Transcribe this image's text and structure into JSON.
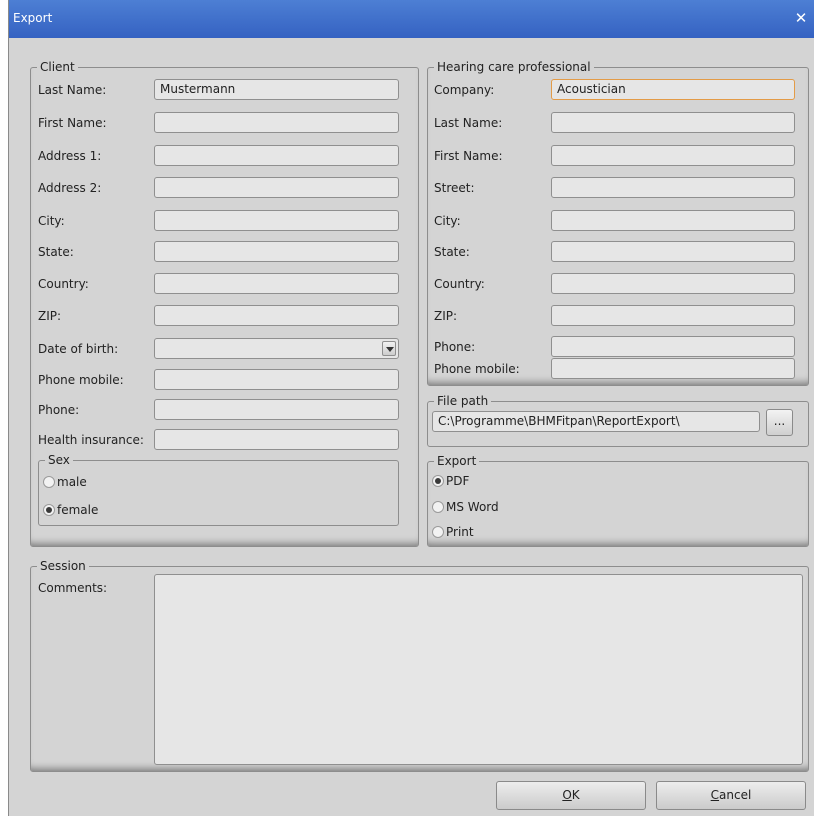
{
  "window": {
    "title": "Export",
    "close_glyph": "✕"
  },
  "client": {
    "legend": "Client",
    "fields": [
      {
        "label": "Last Name:",
        "value": "Mustermann"
      },
      {
        "label": "First Name:",
        "value": ""
      },
      {
        "label": "Address 1:",
        "value": ""
      },
      {
        "label": "Address 2:",
        "value": ""
      },
      {
        "label": "City:",
        "value": ""
      },
      {
        "label": "State:",
        "value": ""
      },
      {
        "label": "Country:",
        "value": ""
      },
      {
        "label": "ZIP:",
        "value": ""
      },
      {
        "label": "Date of birth:",
        "value": ""
      },
      {
        "label": "Phone mobile:",
        "value": ""
      },
      {
        "label": "Phone:",
        "value": ""
      },
      {
        "label": "Health insurance:",
        "value": ""
      }
    ],
    "sex": {
      "legend": "Sex",
      "options": [
        {
          "label": "male",
          "selected": false
        },
        {
          "label": "female",
          "selected": true
        }
      ]
    }
  },
  "hcp": {
    "legend": "Hearing care professional",
    "fields": [
      {
        "label": "Company:",
        "value": "Acoustician"
      },
      {
        "label": "Last Name:",
        "value": ""
      },
      {
        "label": "First Name:",
        "value": ""
      },
      {
        "label": "Street:",
        "value": ""
      },
      {
        "label": "City:",
        "value": ""
      },
      {
        "label": "State:",
        "value": ""
      },
      {
        "label": "Country:",
        "value": ""
      },
      {
        "label": "ZIP:",
        "value": ""
      },
      {
        "label": "Phone:",
        "value": ""
      },
      {
        "label": "Phone mobile:",
        "value": ""
      }
    ]
  },
  "filepath": {
    "legend": "File path",
    "value": "C:\\Programme\\BHMFitpan\\ReportExport\\",
    "browse_label": "..."
  },
  "export": {
    "legend": "Export",
    "options": [
      {
        "label": "PDF",
        "selected": true
      },
      {
        "label": "MS Word",
        "selected": false
      },
      {
        "label": "Print",
        "selected": false
      }
    ]
  },
  "session": {
    "legend": "Session",
    "comments_label": "Comments:",
    "comments_value": ""
  },
  "buttons": {
    "ok_mnemonic": "O",
    "ok_rest": "K",
    "cancel_mnemonic": "C",
    "cancel_rest": "ancel"
  },
  "colors": {
    "title_bar": "#3562c2",
    "focus_border": "#e39b47"
  }
}
